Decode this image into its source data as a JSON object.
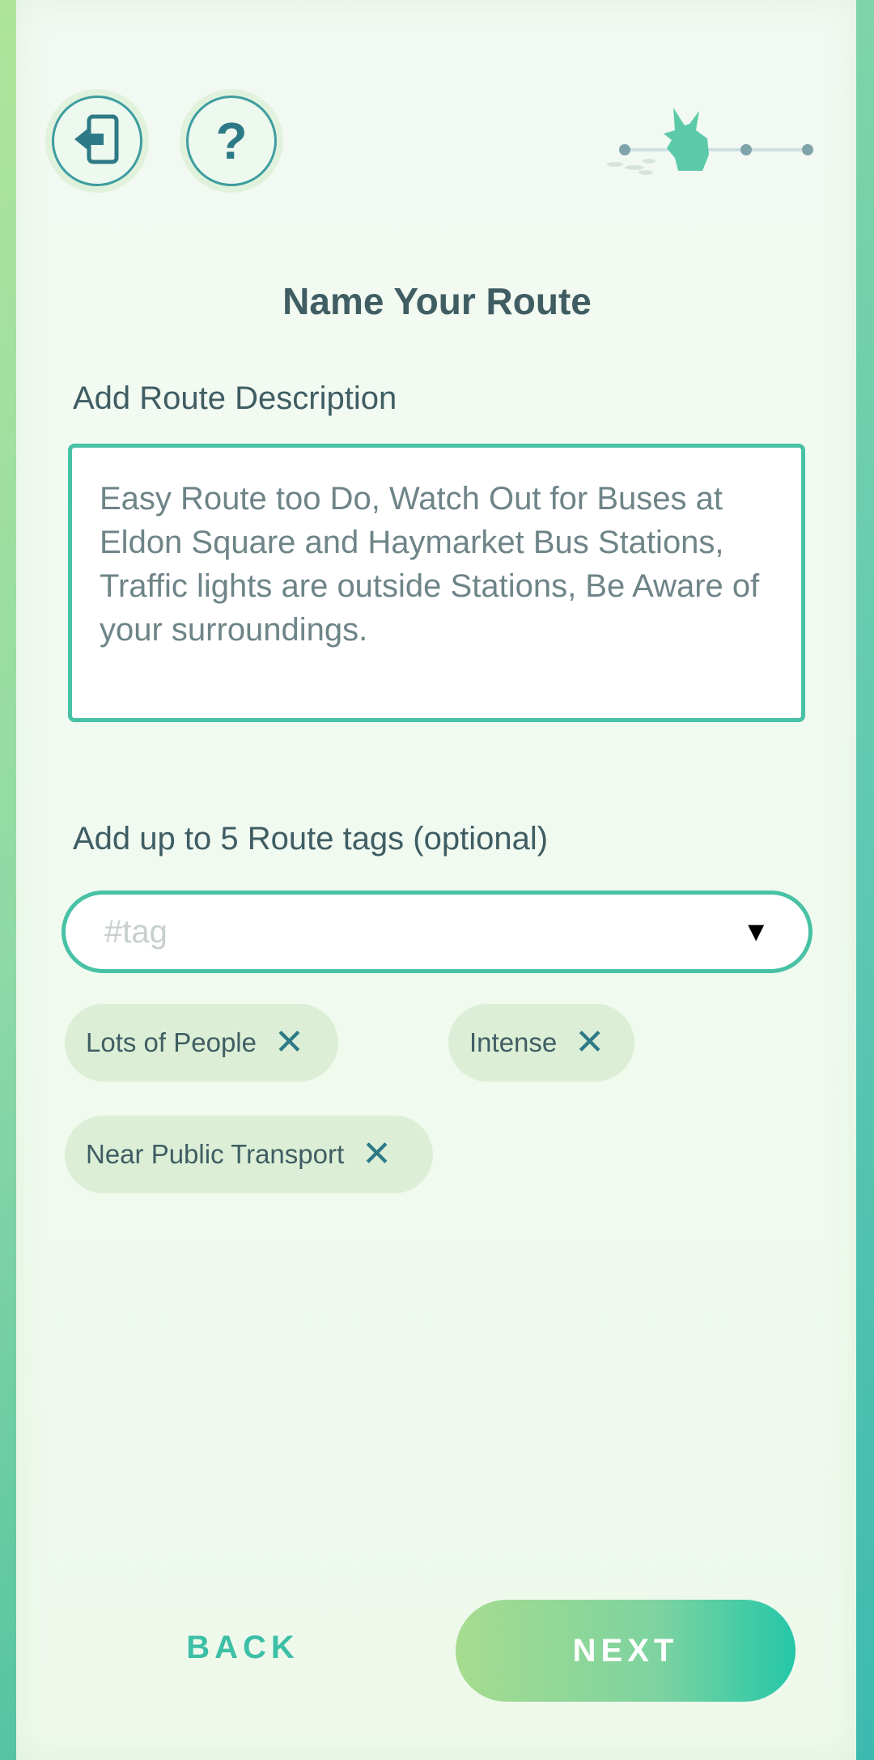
{
  "header": {
    "exit_icon": "exit-door-icon",
    "help_label": "?",
    "progress": {
      "total_steps": 4,
      "current_step": 1,
      "marker_icon": "running-pikachu-icon"
    }
  },
  "page": {
    "title": "Name Your Route"
  },
  "description": {
    "label": "Add Route Description",
    "value": "Easy Route too Do, Watch Out for Buses at Eldon Square and Haymarket Bus Stations, Traffic lights are outside Stations, Be Aware of your surroundings."
  },
  "tags": {
    "label": "Add up to 5 Route tags (optional)",
    "placeholder": "#tag",
    "dropdown_arrow": "▼",
    "selected": [
      {
        "label": "Lots of People",
        "remove": "✕"
      },
      {
        "label": "Intense",
        "remove": "✕"
      },
      {
        "label": "Near Public Transport",
        "remove": "✕"
      }
    ]
  },
  "footer": {
    "back_label": "BACK",
    "next_label": "NEXT"
  },
  "colors": {
    "accent": "#48c1a5",
    "text": "#3f5d63",
    "chip": "#dcefd6",
    "icon": "#2d7a86"
  }
}
